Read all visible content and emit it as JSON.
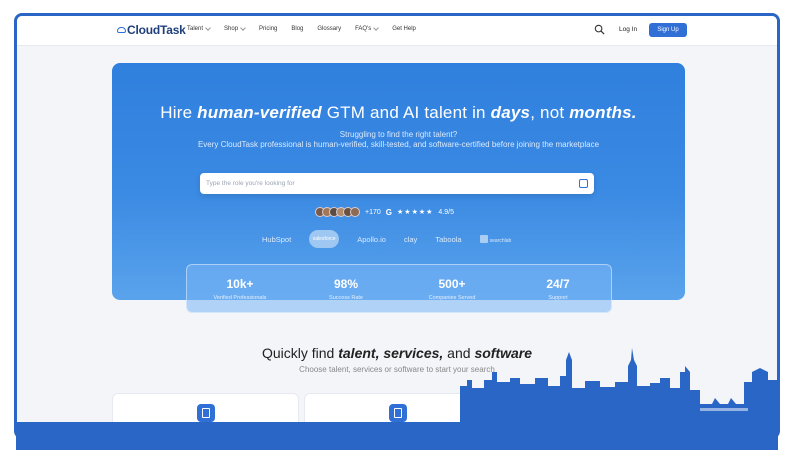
{
  "nav": {
    "logo": "CloudTask",
    "menu": [
      {
        "label": "Talent",
        "has_dropdown": true
      },
      {
        "label": "Shop",
        "has_dropdown": true
      },
      {
        "label": "Pricing",
        "has_dropdown": false
      },
      {
        "label": "Blog",
        "has_dropdown": false
      },
      {
        "label": "Glossary",
        "has_dropdown": false
      },
      {
        "label": "FAQ's",
        "has_dropdown": true
      },
      {
        "label": "Get Help",
        "has_dropdown": false
      }
    ],
    "login": "Log In",
    "signup": "Sign Up"
  },
  "hero": {
    "headline_parts": [
      "Hire ",
      "human-verified",
      " GTM and AI talent in ",
      "days",
      ", not ",
      "months."
    ],
    "sub_line1": "Struggling to find the right talent?",
    "sub_line2": "Every CloudTask professional is human-verified, skill-tested, and software-certified before joining the marketplace",
    "search_placeholder": "Type the role you're looking for",
    "social_count": "+170",
    "google_mark": "G",
    "stars": "★★★★★",
    "rating": "4.9/5",
    "partner_logos": [
      "HubSpot",
      "salesforce",
      "Apollo.io",
      "clay",
      "Taboola",
      "searchlab"
    ]
  },
  "stats": [
    {
      "value": "10k+",
      "label": "Verified Professionals"
    },
    {
      "value": "98%",
      "label": "Success Rate"
    },
    {
      "value": "500+",
      "label": "Companies Served"
    },
    {
      "value": "24/7",
      "label": "Support"
    }
  ],
  "quick": {
    "title_parts": [
      "Quickly find ",
      "talent, services,",
      " and ",
      "software"
    ],
    "subtitle": "Choose talent, services or software to start your search"
  },
  "colors": {
    "brand_blue": "#2f6fd6",
    "frame_border": "#2a66c6",
    "skyline": "#2a66c6"
  }
}
